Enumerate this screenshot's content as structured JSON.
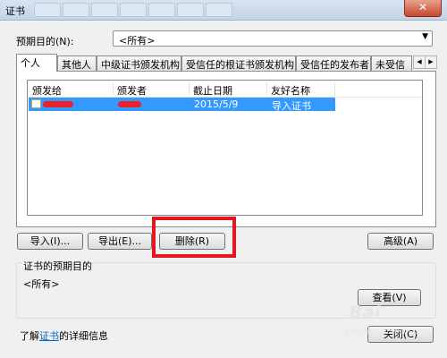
{
  "window": {
    "title": "证书",
    "close_label": "✕"
  },
  "purpose": {
    "label": "预期目的(N):",
    "selected": "<所有>"
  },
  "tabs": [
    {
      "label": "个人",
      "active": true
    },
    {
      "label": "其他人"
    },
    {
      "label": "中级证书颁发机构"
    },
    {
      "label": "受信任的根证书颁发机构"
    },
    {
      "label": "受信任的发布者"
    },
    {
      "label": "未受信"
    }
  ],
  "list": {
    "columns": [
      "颁发给",
      "颁发者",
      "截止日期",
      "友好名称"
    ],
    "rows": [
      {
        "issued_to": "",
        "issuer": "",
        "expires": "2015/5/9",
        "friendly_name": "导入证书",
        "selected": true
      }
    ]
  },
  "buttons": {
    "import": "导入(I)...",
    "export": "导出(E)...",
    "remove": "删除(R)",
    "advanced": "高级(A)",
    "view": "查看(V)",
    "close": "关闭(C)"
  },
  "purposes_group": {
    "title": "证书的预期目的",
    "value": "<所有>"
  },
  "footer": {
    "prefix": "了解",
    "link": "证书",
    "suffix": "的详细信息"
  },
  "watermark": {
    "line1": "Bai",
    "line2": "jingyan.baidu.com"
  },
  "colors": {
    "selection": "#3399ff",
    "highlight_box": "#e5161f",
    "redaction": "#e8222a"
  }
}
